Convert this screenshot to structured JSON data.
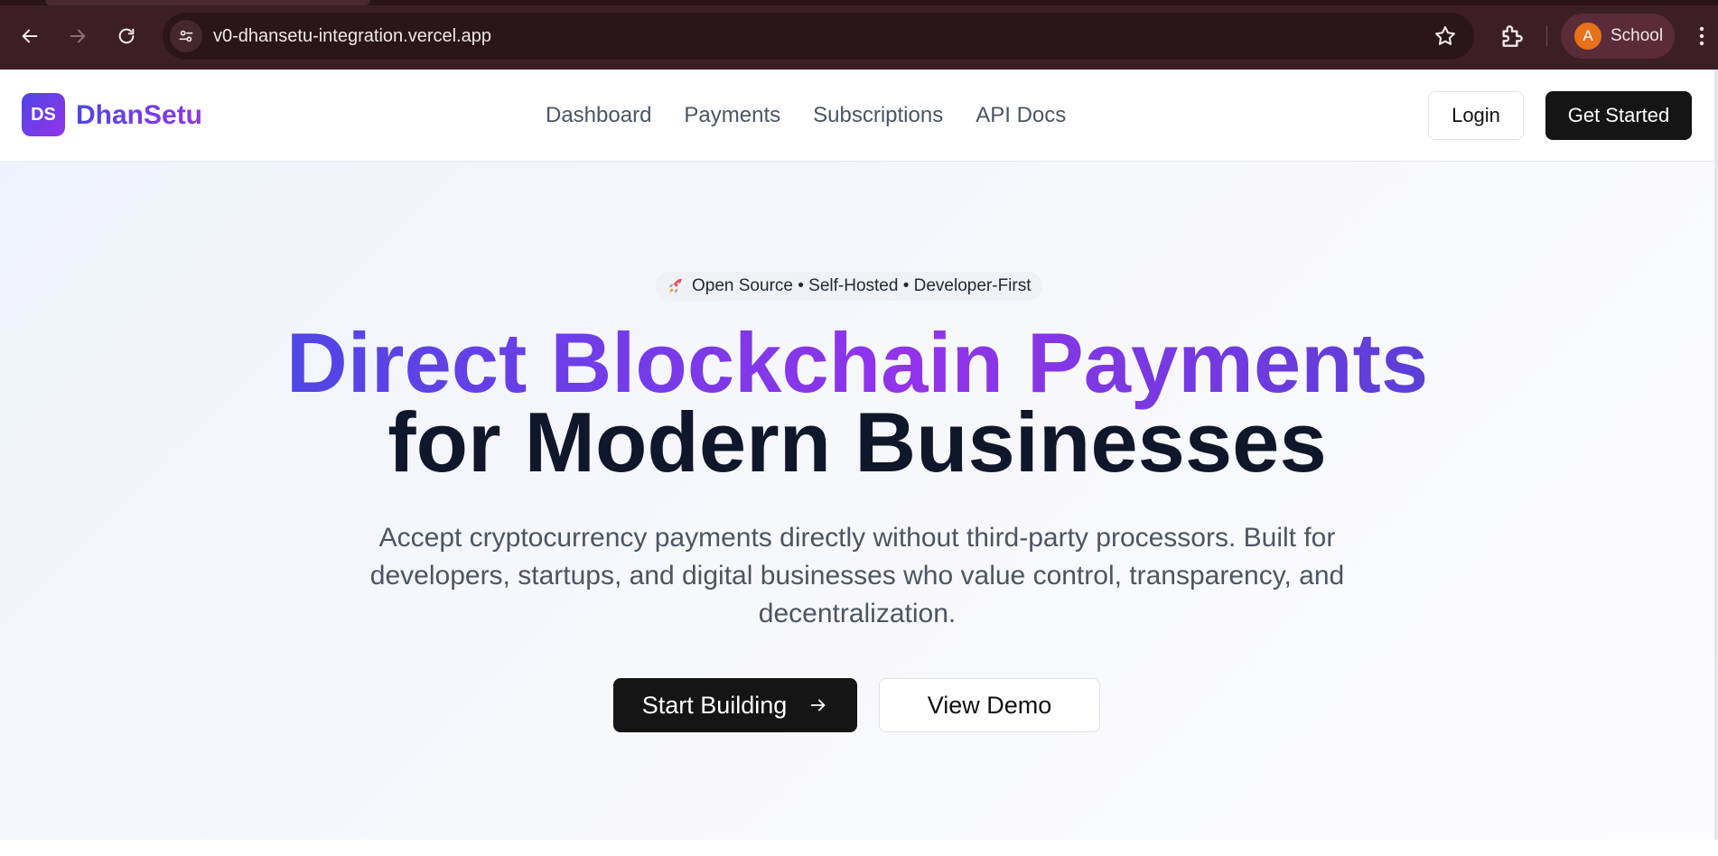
{
  "browser": {
    "url": "v0-dhansetu-integration.vercel.app",
    "profile_initial": "A",
    "profile_name": "School",
    "icons": [
      "back-icon",
      "forward-icon",
      "reload-icon",
      "site-info-icon",
      "star-icon",
      "extensions-icon",
      "menu-icon"
    ]
  },
  "header": {
    "logo_initials": "DS",
    "brand_name": "DhanSetu",
    "nav": [
      "Dashboard",
      "Payments",
      "Subscriptions",
      "API Docs"
    ],
    "login_label": "Login",
    "get_started_label": "Get Started"
  },
  "hero": {
    "badge_text": "Open Source • Self-Hosted • Developer-First",
    "title_line1": "Direct Blockchain Payments",
    "title_line2": "for Modern Businesses",
    "subtitle": "Accept cryptocurrency payments directly without third-party processors. Built for developers, startups, and digital businesses who value control, transparency, and decentralization.",
    "primary_cta": "Start Building",
    "secondary_cta": "View Demo"
  },
  "colors": {
    "brand_gradient_start": "#4f46e5",
    "brand_gradient_end": "#9333ea",
    "dark_button": "#151515",
    "chrome_bg": "#3c1f26"
  }
}
